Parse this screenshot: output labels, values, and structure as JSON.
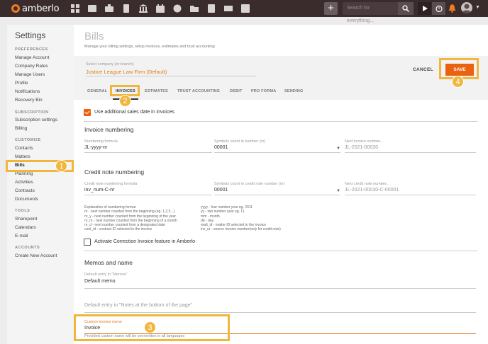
{
  "app": {
    "logo_text": "amberlo"
  },
  "topbar": {
    "nav_icons": [
      "dashboard-icon",
      "contacts-icon",
      "matters-icon",
      "bills-icon",
      "bank-icon",
      "calendar-icon",
      "time-icon",
      "folder-icon",
      "documents-icon",
      "mail-icon",
      "reports-icon"
    ],
    "plus_label": "+",
    "search_placeholder": "Search for everything..."
  },
  "sidebar": {
    "title": "Settings",
    "sections": [
      {
        "label": "PREFERENCES",
        "items": [
          "Manage Account",
          "Company Rates",
          "Manage Users",
          "Profile",
          "Notifications",
          "Recovery Bin"
        ]
      },
      {
        "label": "SUBSCRIPTION",
        "items": [
          "Subscription settings",
          "Billing"
        ]
      },
      {
        "label": "CUSTOMIZE",
        "items": [
          "Contacts",
          "Matters",
          "Bills",
          "Planning",
          "Activities",
          "Contracts",
          "Documents"
        ]
      },
      {
        "label": "TOOLS",
        "items": [
          "Sharepoint",
          "Calendars",
          "E-mail"
        ]
      },
      {
        "label": "ACCOUNTS",
        "items": [
          "Create New Account"
        ]
      }
    ],
    "active_item": "Bills"
  },
  "page": {
    "title": "Bills",
    "subtitle": "Manage your billing settings, setup invoices, estimates and trust accounting",
    "company_label": "Select company (or branch)",
    "company_value": "Justice League Law Firm (Default)",
    "cancel_label": "CANCEL",
    "save_label": "SAVE"
  },
  "tabs": [
    "GENERAL",
    "INVOICES",
    "ESTIMATES",
    "TRUST ACCOUNTING",
    "DEBIT",
    "PRO FORMA",
    "SENDING"
  ],
  "active_tab": "INVOICES",
  "form": {
    "use_sales_date": "Use additional sales date in invoices",
    "invoice_numbering": {
      "heading": "Invoice numbering",
      "formula_label": "Numbering formula",
      "formula_value": "JL-yyyy-nr",
      "symbols_label": "Symbols count in number (nr)",
      "symbols_value": "00001",
      "next_label": "Next invoice number...",
      "next_value": "JL-2021-00030"
    },
    "credit_numbering": {
      "heading": "Credit note numbering",
      "formula_label": "Credit note numbering formula",
      "formula_value": "inv_num-C-nr",
      "symbols_label": "Symbols count in credit note number (nr)",
      "symbols_value": "00001",
      "next_label": "Next credit note number...",
      "next_value": "JL-2021-00030-C-00001"
    },
    "explanation_left": [
      "Explanation of numbering format",
      "nr - next number counted from the beginning (eg. 1,2,3...)",
      "nr_y - next number counted from the beginning of the year",
      "nr_m - next number counted from the beginning of a month",
      "nr_d - next number counted from a designated date",
      "cont_id - contract ID selected in the invoice"
    ],
    "explanation_right": [
      "yyyy - four number year eg. 2011",
      "yy - two number year eg. 11",
      "mm - month",
      "dd - day",
      "matt_id - matter ID selected in the invoice",
      "inv_nr - source invoice number(only for credit note)"
    ],
    "correction_label": "Activate Correction Invoice feature in Amberlo",
    "memos": {
      "heading": "Memos and name",
      "memo_label": "Default entry in \"Memos\"",
      "memo_value": "Default memo",
      "notes_placeholder": "Default entry in \"Notes at the bottom of the page\"",
      "custom_name_label": "Custom invoice name",
      "custom_name_value": "Invoice",
      "custom_name_hint": "Provided custom name will be overwritten in all languages"
    }
  },
  "callouts": [
    "1",
    "2",
    "3",
    "4"
  ],
  "colors": {
    "topbar": "#3a2b2d",
    "accent": "#e8620f",
    "callout": "#f1b63d",
    "company_text": "#e07b1f"
  }
}
